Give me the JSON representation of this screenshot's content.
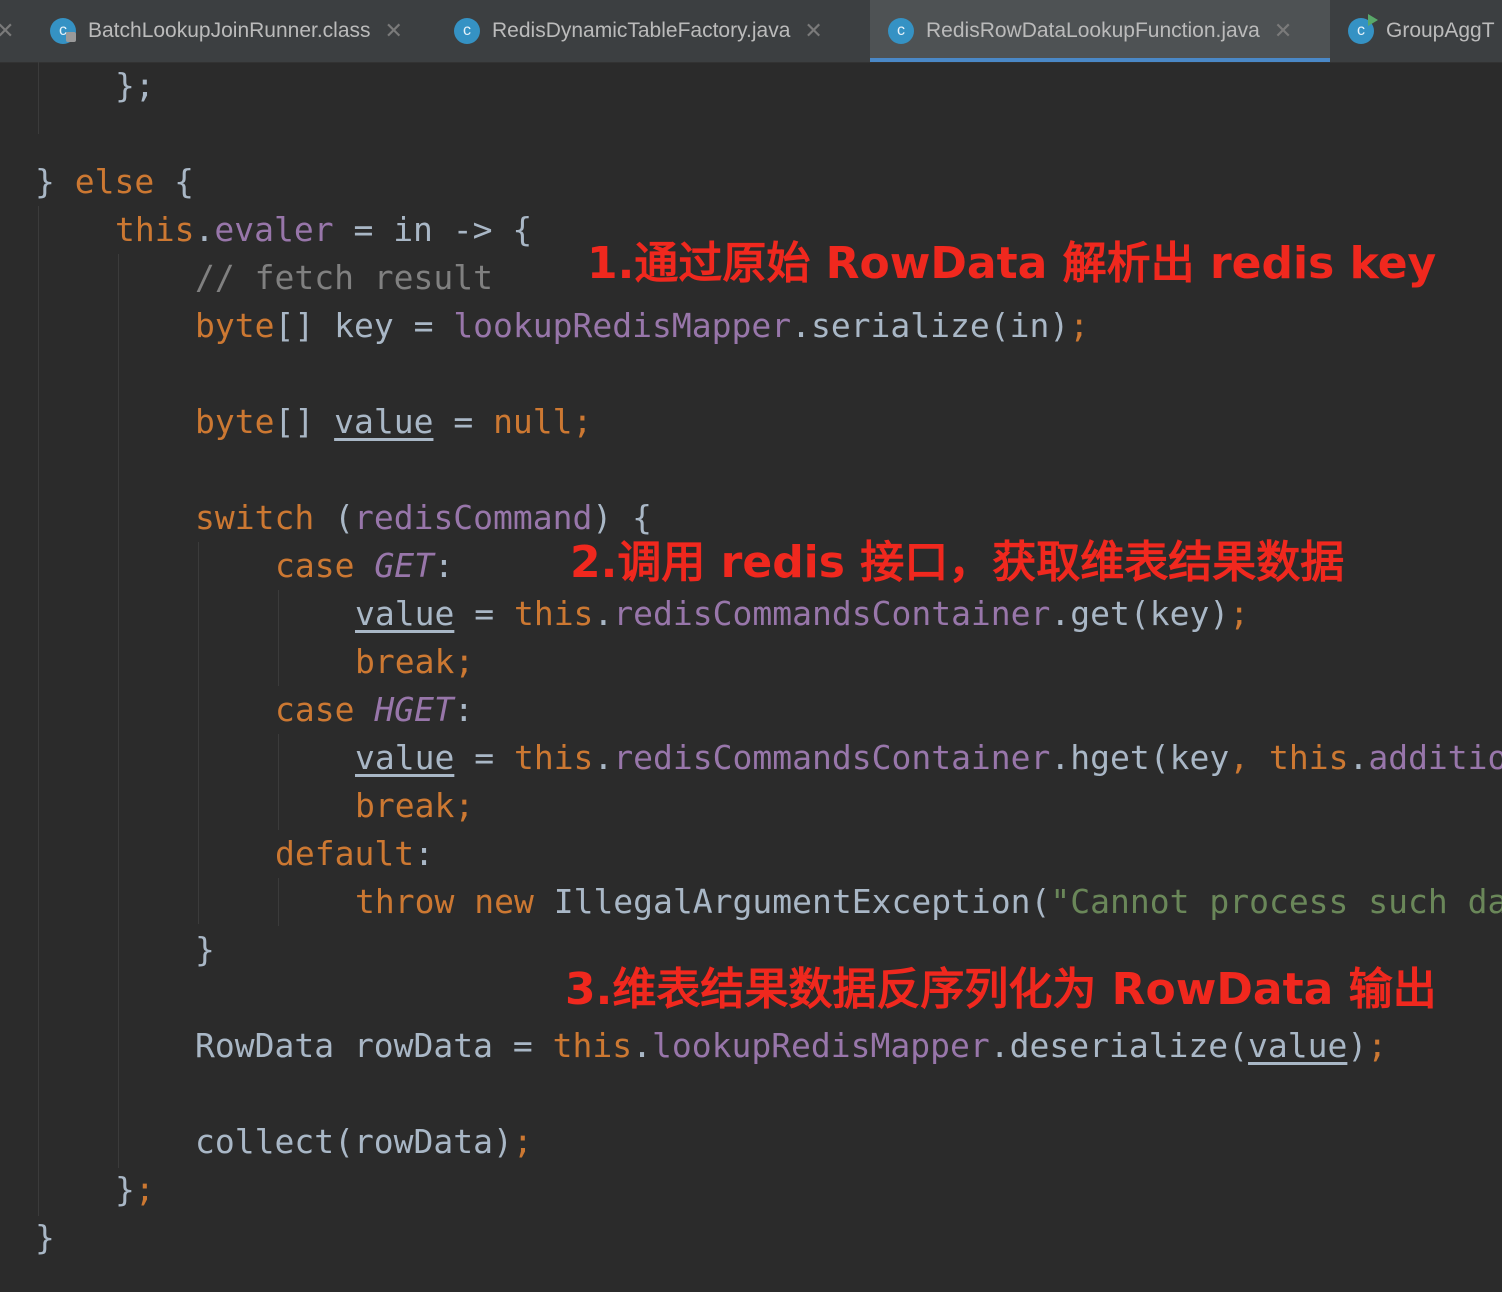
{
  "tabs": [
    {
      "label": "BatchLookupJoinRunner.class",
      "icon": "class-locked-icon"
    },
    {
      "label": "RedisDynamicTableFactory.java",
      "icon": "class-icon"
    },
    {
      "label": "RedisRowDataLookupFunction.java",
      "icon": "class-icon",
      "active": true
    },
    {
      "label": "GroupAggT",
      "icon": "class-run-icon"
    }
  ],
  "close_glyph": "✕",
  "class_glyph": "c",
  "code": {
    "brace_semicolon": "};",
    "else_close": "}",
    "else_kw": "else",
    "open_brace": "{",
    "this_kw": "this",
    "evaler": "evaler",
    "assign": " = ",
    "lambda": "in -> {",
    "comment_fetch": "// fetch result",
    "byte_kw": "byte",
    "brackets": "[]",
    "key_decl": " key = ",
    "lookup_mapper": "lookupRedisMapper",
    "serialize_call": ".serialize(in)",
    "semi": ";",
    "value_var": "value",
    "null_kw": "null",
    "switch_kw": "switch",
    "switch_arg_open": " (",
    "redis_command": "redisCommand",
    "switch_arg_close": ") {",
    "case_kw": "case",
    "get_const": "GET",
    "hget_const": "HGET",
    "colon": ":",
    "dot": ".",
    "container": "redisCommandsContainer",
    "get_call": ".get(key)",
    "hget_call": ".hget(key",
    "comma": ",",
    "additio": "additio",
    "break_kw": "break",
    "default_kw": "default",
    "throw_kw": "throw",
    "new_kw": "new",
    "exception_cls": "IllegalArgumentException(",
    "error_string": "\"Cannot process such da",
    "close_brace": "}",
    "rowdata_decl": "RowData rowData",
    "deserialize_call": ".deserialize(",
    "close_paren": ")",
    "collect_call": "collect(rowData)"
  },
  "annotations": {
    "step1": "1.通过原始 RowData 解析出 redis key",
    "step2": "2.调用 redis 接口，获取维表结果数据",
    "step3": "3.维表结果数据反序列化为 RowData 输出"
  },
  "colors": {
    "background": "#2b2b2b",
    "keyword": "#cc7832",
    "field": "#9876aa",
    "comment": "#808080",
    "string": "#6a8759",
    "plain": "#a9b7c6",
    "annotation": "#f0281e",
    "active_tab_underline": "#4a88c7"
  }
}
